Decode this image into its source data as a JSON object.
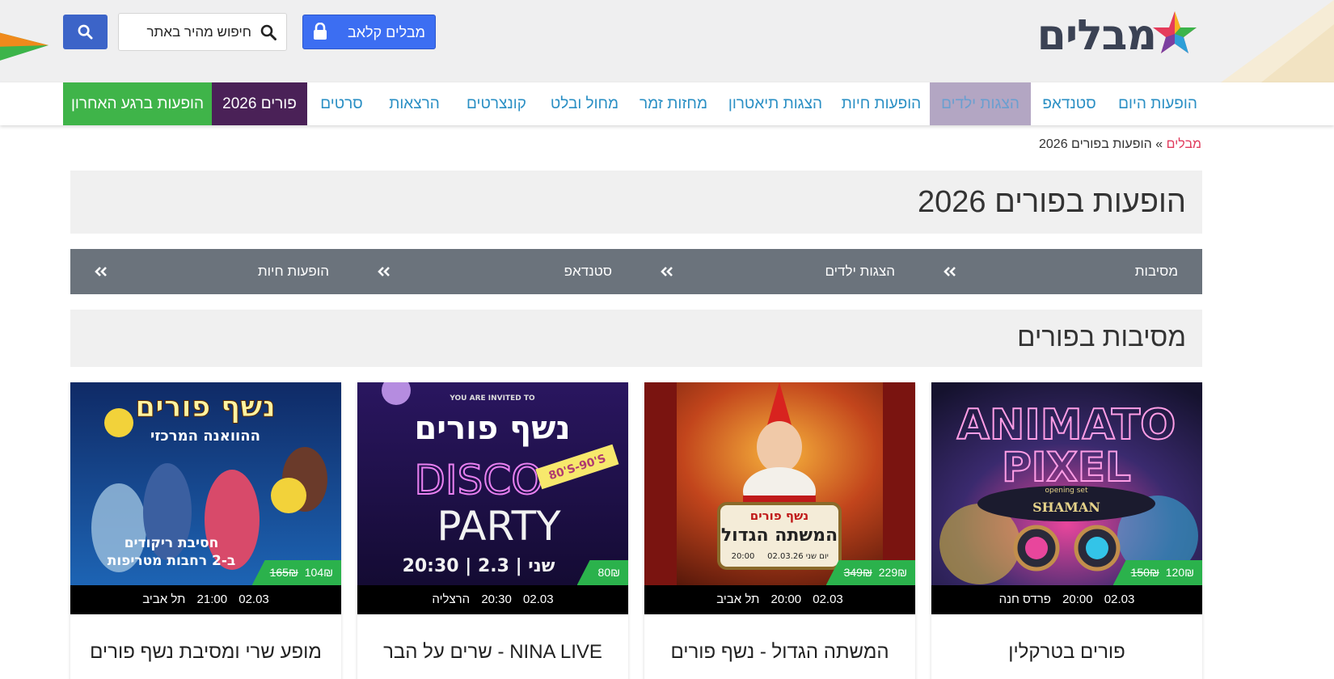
{
  "header": {
    "logo_text": "מבלים",
    "club_button": "מבלים קלאב",
    "search_placeholder": "חיפוש מהיר באתר",
    "colors": {
      "club_blue": "#3c6ef2",
      "search_blue": "#3c64c8",
      "logo_dark": "#3b4254"
    }
  },
  "nav": {
    "items": [
      "הופעות היום",
      "סטנדאפ",
      "הצגות ילדים",
      "הופעות חיות",
      "הצגות תיאטרון",
      "מחזות זמר",
      "מחול ובלט",
      "קונצרטים",
      "הרצאות",
      "סרטים",
      "פורים 2026",
      "הופעות ברגע האחרון"
    ],
    "colors": {
      "link": "#2a8fc4",
      "active_kids_bg": "#b3a6c3",
      "purim_bg": "#4a2157",
      "last_minute_bg": "#3fb449"
    }
  },
  "breadcrumb": {
    "home": "מבלים",
    "separator": "»",
    "current": "הופעות בפורים 2026"
  },
  "page": {
    "title": "הופעות בפורים 2026"
  },
  "subnav": {
    "items": [
      "מסיבות",
      "הצגות ילדים",
      "סטנדאפ",
      "הופעות חיות"
    ]
  },
  "section": {
    "title": "מסיבות בפורים"
  },
  "cards": [
    {
      "poster_lines": [
        "ANIMATO",
        "PIXEL",
        "opening set",
        "SHAMAN"
      ],
      "price_new": "120₪",
      "price_old": "150₪",
      "date": "02.03",
      "time": "20:00",
      "city": "פרדס חנה",
      "name": "פורים בטרקלין"
    },
    {
      "poster_lines": [
        "נשף פורים",
        "המשתה הגדול",
        "02.03.26 יום שני",
        "20:00"
      ],
      "price_new": "229₪",
      "price_old": "349₪",
      "date": "02.03",
      "time": "20:00",
      "city": "תל אביב",
      "name": "המשתה הגדול - נשף פורים"
    },
    {
      "poster_lines": [
        "YOU ARE INVITED TO",
        "נשף פורים",
        "DISCO",
        "PARTY",
        "80'S-90'S",
        "20:30 | 2.3 | שני"
      ],
      "price_new": "80₪",
      "price_old": "",
      "date": "02.03",
      "time": "20:30",
      "city": "הרצליה",
      "name": "NINA LIVE - שרים על הבר"
    },
    {
      "poster_lines": [
        "נשף פורים",
        "ההוואנה המרכזי",
        "חסיבת ריקודים",
        "ב-2 רחבות מטריפות"
      ],
      "price_new": "104₪",
      "price_old": "165₪",
      "date": "02.03",
      "time": "21:00",
      "city": "תל אביב",
      "name": "מופע שרי ומסיבת נשף פורים"
    }
  ]
}
